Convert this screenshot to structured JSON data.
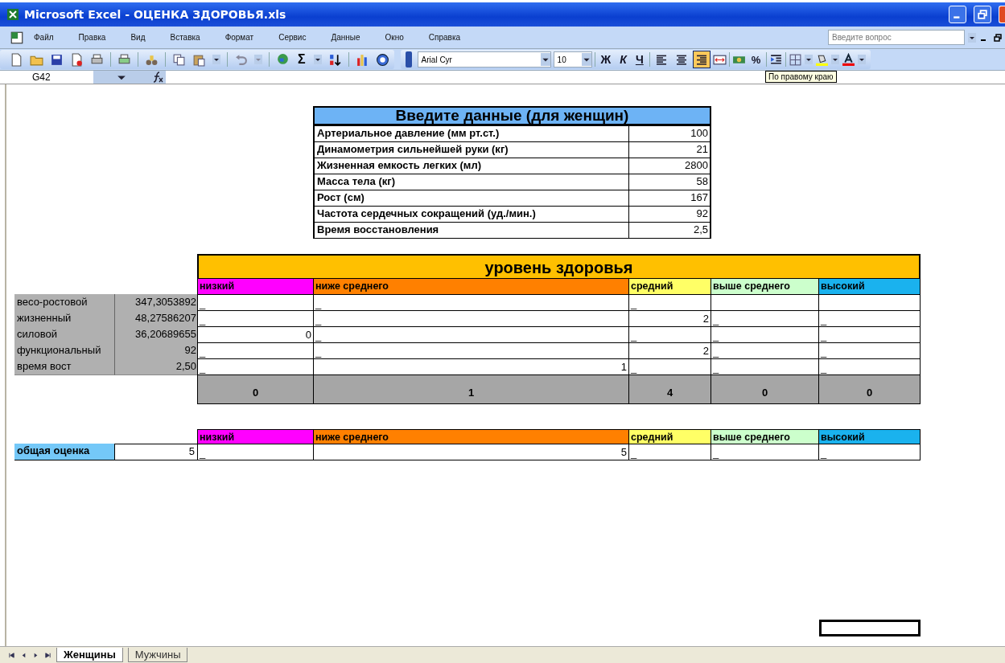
{
  "window": {
    "title": "Microsoft Excel - ОЦЕНКА ЗДОРОВЬЯ.xls"
  },
  "menu": [
    "Файл",
    "Правка",
    "Вид",
    "Вставка",
    "Формат",
    "Сервис",
    "Данные",
    "Окно",
    "Справка"
  ],
  "help_field": {
    "placeholder": "Введите вопрос"
  },
  "standard_toolbar": {
    "sum": "Σ"
  },
  "format_toolbar": {
    "font": "Arial Cyr",
    "size": "10",
    "bold": "Ж",
    "italic": "К",
    "underline": "Ч",
    "percent": "%",
    "align_buttons": [
      {
        "selected": false
      },
      {
        "selected": false
      },
      {
        "selected": true
      }
    ],
    "tooltip": "По правому краю"
  },
  "formula_bar": {
    "name_box": "G42"
  },
  "input_table": {
    "title": "Введите данные (для женщин)",
    "rows": [
      {
        "label": "Артериальное давление (мм рт.ст.)",
        "value": "100"
      },
      {
        "label": "Динамометрия сильнейшей руки (кг)",
        "value": "21"
      },
      {
        "label": "Жизненная емкость легких (мл)",
        "value": "2800"
      },
      {
        "label": "Масса тела (кг)",
        "value": "58"
      },
      {
        "label": "Рост (см)",
        "value": "167"
      },
      {
        "label": "Частота сердечных сокращений (уд./мин.)",
        "value": "92"
      },
      {
        "label": "Время восстановления",
        "value": "2,5"
      }
    ]
  },
  "level_table": {
    "title": "уровень здоровья",
    "levels": [
      {
        "label": "низкий",
        "color": "#ff00ff"
      },
      {
        "label": "ниже среднего",
        "color": "#ff8000"
      },
      {
        "label": "средний",
        "color": "#ffff66"
      },
      {
        "label": "выше среднего",
        "color": "#ccffcc"
      },
      {
        "label": "высокий",
        "color": "#1ab2ee"
      }
    ],
    "rows": [
      {
        "label": "весо-ростовой",
        "value": "347,3053892",
        "cells": [
          {
            "kind": "mark",
            "text": "_"
          },
          {
            "kind": "mark",
            "text": "_"
          },
          {
            "kind": "mark",
            "text": "_"
          },
          {
            "kind": "empty"
          },
          {
            "kind": "empty"
          }
        ]
      },
      {
        "label": "жизненный",
        "value": "48,27586207",
        "cells": [
          {
            "kind": "mark",
            "text": "_"
          },
          {
            "kind": "mark",
            "text": "_"
          },
          {
            "kind": "number",
            "text": "2"
          },
          {
            "kind": "mark",
            "text": "_"
          },
          {
            "kind": "mark",
            "text": "_"
          }
        ]
      },
      {
        "label": "силовой",
        "value": "36,20689655",
        "cells": [
          {
            "kind": "number",
            "text": "0"
          },
          {
            "kind": "mark",
            "text": "_"
          },
          {
            "kind": "mark",
            "text": "_"
          },
          {
            "kind": "mark",
            "text": "_"
          },
          {
            "kind": "mark",
            "text": "_"
          }
        ]
      },
      {
        "label": "функциональный",
        "value": "92",
        "cells": [
          {
            "kind": "mark",
            "text": "_"
          },
          {
            "kind": "mark",
            "text": "_"
          },
          {
            "kind": "number",
            "text": "2"
          },
          {
            "kind": "mark",
            "text": "_"
          },
          {
            "kind": "mark",
            "text": "_"
          }
        ]
      },
      {
        "label": "время вост",
        "value": "2,50",
        "cells": [
          {
            "kind": "mark",
            "text": "_"
          },
          {
            "kind": "number",
            "text": "1"
          },
          {
            "kind": "mark",
            "text": "_"
          },
          {
            "kind": "mark",
            "text": "_"
          },
          {
            "kind": "mark",
            "text": "_"
          }
        ]
      }
    ],
    "totals": [
      "0",
      "1",
      "4",
      "0",
      "0"
    ]
  },
  "overall_table": {
    "levels": [
      {
        "label": "низкий",
        "color": "#ff00ff"
      },
      {
        "label": "ниже среднего",
        "color": "#ff8000"
      },
      {
        "label": "средний",
        "color": "#ffff66"
      },
      {
        "label": "выше среднего",
        "color": "#ccffcc"
      },
      {
        "label": "высокий",
        "color": "#1ab2ee"
      }
    ],
    "label": "общая оценка",
    "value": "5",
    "cells": [
      {
        "kind": "mark",
        "text": "_"
      },
      {
        "kind": "number",
        "text": "5"
      },
      {
        "kind": "mark",
        "text": "_"
      },
      {
        "kind": "mark",
        "text": "_"
      },
      {
        "kind": "mark",
        "text": "_"
      }
    ]
  },
  "sheet_tabs": [
    {
      "label": "Женщины",
      "selected": true
    },
    {
      "label": "Мужчины",
      "selected": false
    }
  ]
}
